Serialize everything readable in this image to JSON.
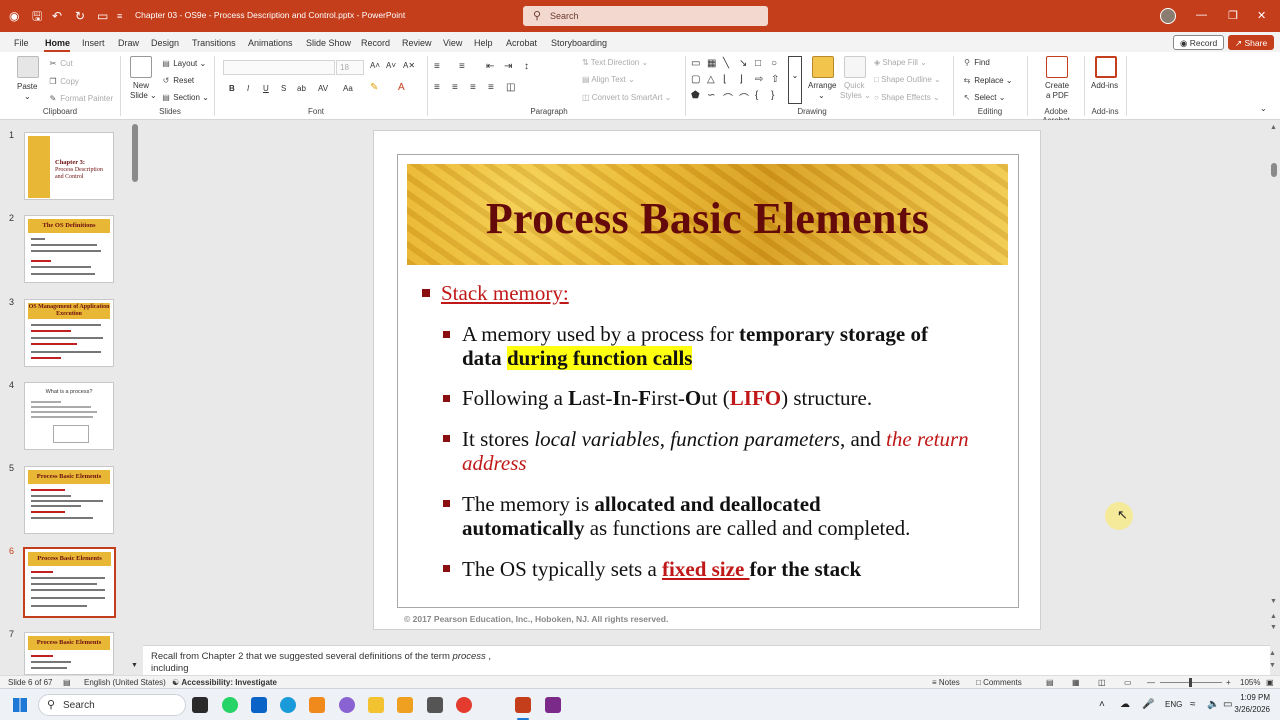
{
  "window": {
    "title": "Chapter 03 - OS9e",
    "title_suffix": " - Process Description and Control.pptx  -  PowerPoint",
    "search_placeholder": "Search"
  },
  "menu": {
    "tabs": [
      "File",
      "Home",
      "Insert",
      "Draw",
      "Design",
      "Transitions",
      "Animations",
      "Slide Show",
      "Record",
      "Review",
      "View",
      "Help",
      "Acrobat",
      "Storyboarding"
    ],
    "record_btn": "Record",
    "share_btn": "Share"
  },
  "ribbon": {
    "clipboard": {
      "paste": "Paste",
      "cut": "Cut",
      "copy": "Copy",
      "format_painter": "Format Painter",
      "group": "Clipboard"
    },
    "slides": {
      "new_slide": "New",
      "new_slide2": "Slide",
      "layout": "Layout",
      "reset": "Reset",
      "section": "Section",
      "group": "Slides"
    },
    "font": {
      "size": "18",
      "group": "Font"
    },
    "paragraph": {
      "text_direction": "Text Direction",
      "align_text": "Align Text",
      "smartart": "Convert to SmartArt",
      "group": "Paragraph"
    },
    "drawing": {
      "arrange": "Arrange",
      "quick_styles": "Quick",
      "quick_styles2": "Styles",
      "shape_fill": "Shape Fill",
      "shape_outline": "Shape Outline",
      "shape_effects": "Shape Effects",
      "group": "Drawing"
    },
    "editing": {
      "find": "Find",
      "replace": "Replace",
      "select": "Select",
      "group": "Editing"
    },
    "acrobat": {
      "create_pdf": "Create",
      "create_pdf2": "a PDF",
      "group": "Adobe Acrobat"
    },
    "addins": {
      "label": "Add-ins",
      "group": "Add-ins"
    }
  },
  "thumbnails": [
    {
      "num": "1",
      "title": "Chapter 3:",
      "subtitle": "Process Description and Control"
    },
    {
      "num": "2",
      "title": "The OS Definitions"
    },
    {
      "num": "3",
      "title": "OS Management of Application Execution"
    },
    {
      "num": "4",
      "title": "What is a process?"
    },
    {
      "num": "5",
      "title": "Process Basic Elements"
    },
    {
      "num": "6",
      "title": "Process Basic Elements"
    },
    {
      "num": "7",
      "title": "Process Basic Elements"
    }
  ],
  "slide": {
    "title": "Process Basic Elements",
    "heading": "Stack memory:",
    "b1_a": " A memory used by a process for ",
    "b1_b": "temporary storage of",
    "b1_c": "data ",
    "b1_d": "during function calls",
    "b2_a": " Following a ",
    "b2_b": "L",
    "b2_c": "ast-",
    "b2_d": "I",
    "b2_e": "n-",
    "b2_f": "F",
    "b2_g": "irst-",
    "b2_h": "O",
    "b2_i": "ut (",
    "b2_j": "LIFO",
    "b2_k": ") structure.",
    "b3_a": "It stores ",
    "b3_b": "local variables",
    "b3_c": ", ",
    "b3_d": "function parameters",
    "b3_e": ", and ",
    "b3_f": "the return",
    "b3_g": "address",
    "b4_a": "The memory is ",
    "b4_b": "allocated and deallocated",
    "b4_c": "automatically",
    "b4_d": " as functions are called and completed.",
    "b5_a": " The OS typically sets a ",
    "b5_b": "fixed size ",
    "b5_c": "for the stack",
    "copyright": "© 2017 Pearson Education, Inc., Hoboken, NJ. All rights reserved."
  },
  "notes": {
    "text_a": "Recall from Chapter 2 that we suggested several definitions of the term ",
    "text_b": "process",
    "text_c": " ,",
    "text_d": "including"
  },
  "status": {
    "slide_of": "Slide 6 of 67",
    "language": "English (United States)",
    "accessibility": "Accessibility: Investigate",
    "notes": "Notes",
    "comments": "Comments",
    "zoom": "105%"
  },
  "taskbar": {
    "search": "Search",
    "lang": "ENG",
    "time": "1:09 PM",
    "date": "3/26/2026"
  },
  "colors": {
    "accent": "#c43e1c",
    "title_red": "#650a0a",
    "text_red": "#c01818",
    "highlight": "#ffff10"
  }
}
